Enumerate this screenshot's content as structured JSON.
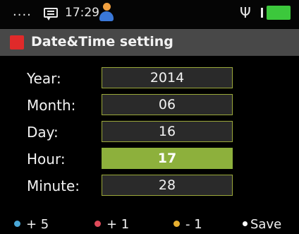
{
  "status": {
    "dots": "....",
    "time": "17:29",
    "usb_symbol": "Ψ"
  },
  "title": {
    "text": "Date&Time setting",
    "accent_color": "#e02a2a"
  },
  "fields": [
    {
      "label": "Year:",
      "value": "2014",
      "selected": false
    },
    {
      "label": "Month:",
      "value": "06",
      "selected": false
    },
    {
      "label": "Day:",
      "value": "16",
      "selected": false
    },
    {
      "label": "Hour:",
      "value": "17",
      "selected": true
    },
    {
      "label": "Minute:",
      "value": "28",
      "selected": false
    }
  ],
  "footer": {
    "keys": [
      {
        "label": "+ 5",
        "color": "#4aa8d8"
      },
      {
        "label": "+ 1",
        "color": "#e04a5a"
      },
      {
        "label": "- 1",
        "color": "#e8b030"
      },
      {
        "label": "Save",
        "color": "#ffffff"
      }
    ]
  },
  "colors": {
    "selected_fill": "#8db03c",
    "box_border": "#9aa83a",
    "battery": "#3cc83c"
  }
}
